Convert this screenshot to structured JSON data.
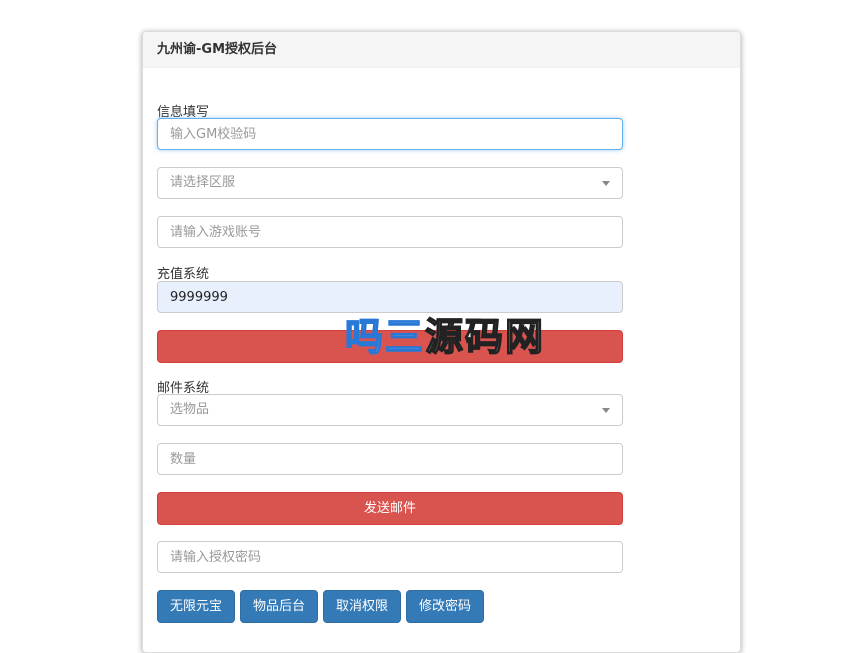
{
  "panel": {
    "title": "九州谕-GM授权后台"
  },
  "info": {
    "section_label": "信息填写",
    "gm_code_placeholder": "输入GM校验码",
    "server_select_value": "请选择区服",
    "account_placeholder": "请输入游戏账号"
  },
  "recharge": {
    "section_label": "充值系统",
    "amount_value": "9999999"
  },
  "mail": {
    "section_label": "邮件系统",
    "item_select_value": "选物品",
    "quantity_placeholder": "数量",
    "send_button": "发送邮件"
  },
  "auth": {
    "password_placeholder": "请输入授权密码",
    "buttons": [
      "无限元宝",
      "物品后台",
      "取消权限",
      "修改密码"
    ]
  },
  "watermark": {
    "text_left": "吗",
    "text_middle": "三",
    "text_right": "源码网"
  },
  "colors": {
    "danger": "#d9534f",
    "primary": "#337ab7",
    "focus": "#66afe9"
  }
}
